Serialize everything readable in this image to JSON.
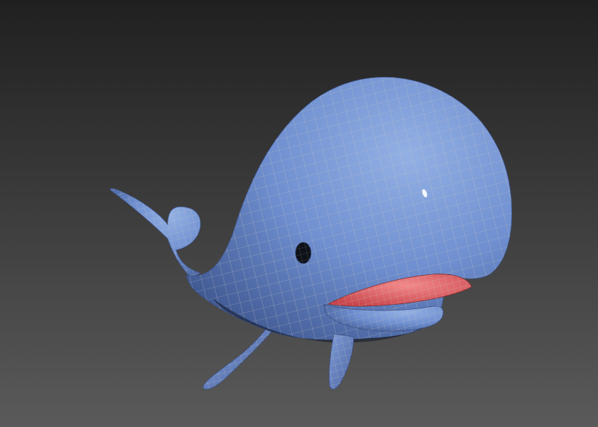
{
  "scene": {
    "subject": "whale-3d-model",
    "colors": {
      "background_top": "#202020",
      "background_bottom": "#5a5a5a",
      "body_light": "#93b0e4",
      "body_mid": "#6f8fd0",
      "body_dark": "#3e5790",
      "mouth_light": "#f3888a",
      "mouth_dark": "#c8464c",
      "wireframe": "#c9c6bd",
      "eye": "#0e1118"
    }
  }
}
